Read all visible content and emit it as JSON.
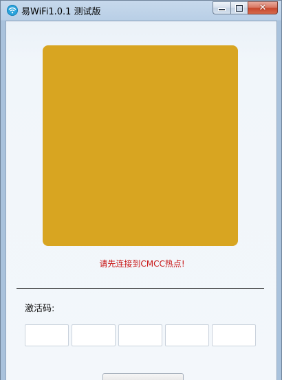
{
  "window": {
    "title": "易WiFi1.0.1 测试版",
    "icon": "wifi-icon",
    "controls": {
      "minimize": "minimize-icon",
      "maximize": "maximize-icon",
      "close_glyph": "✕"
    }
  },
  "main": {
    "qr_placeholder_color": "#d8a521",
    "status_message": "请先连接到CMCC热点!",
    "status_color": "#c81414",
    "activation_label": "激活码:",
    "code_fields": [
      {
        "value": ""
      },
      {
        "value": ""
      },
      {
        "value": ""
      },
      {
        "value": ""
      },
      {
        "value": ""
      }
    ],
    "bottom_button_label": ""
  }
}
